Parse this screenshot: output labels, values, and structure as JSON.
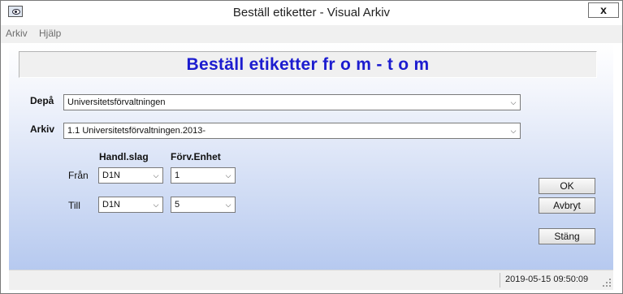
{
  "window": {
    "title": "Beställ etiketter - Visual Arkiv",
    "close_label": "x"
  },
  "menu": {
    "items": [
      "Arkiv",
      "Hjälp"
    ]
  },
  "heading": "Beställ etiketter fr o m - t o m",
  "form": {
    "depa_label": "Depå",
    "depa_value": "Universitetsförvaltningen",
    "arkiv_label": "Arkiv",
    "arkiv_value": "1.1   Universitetsförvaltningen.2013-",
    "handl_header": "Handl.slag",
    "forv_header": "Förv.Enhet",
    "fran_label": "Från",
    "till_label": "Till",
    "fran_handl": "D1N",
    "fran_forv": "1",
    "till_handl": "D1N",
    "till_forv": "5"
  },
  "buttons": {
    "ok": "OK",
    "cancel": "Avbryt",
    "close": "Stäng"
  },
  "status": {
    "datetime": "2019-05-15 09:50:09"
  },
  "icons": {
    "dropdown": "chevron-down-icon",
    "app": "eye-icon"
  },
  "colors": {
    "heading": "#1c1ccf",
    "gradient_bottom": "#b6c9ef"
  }
}
